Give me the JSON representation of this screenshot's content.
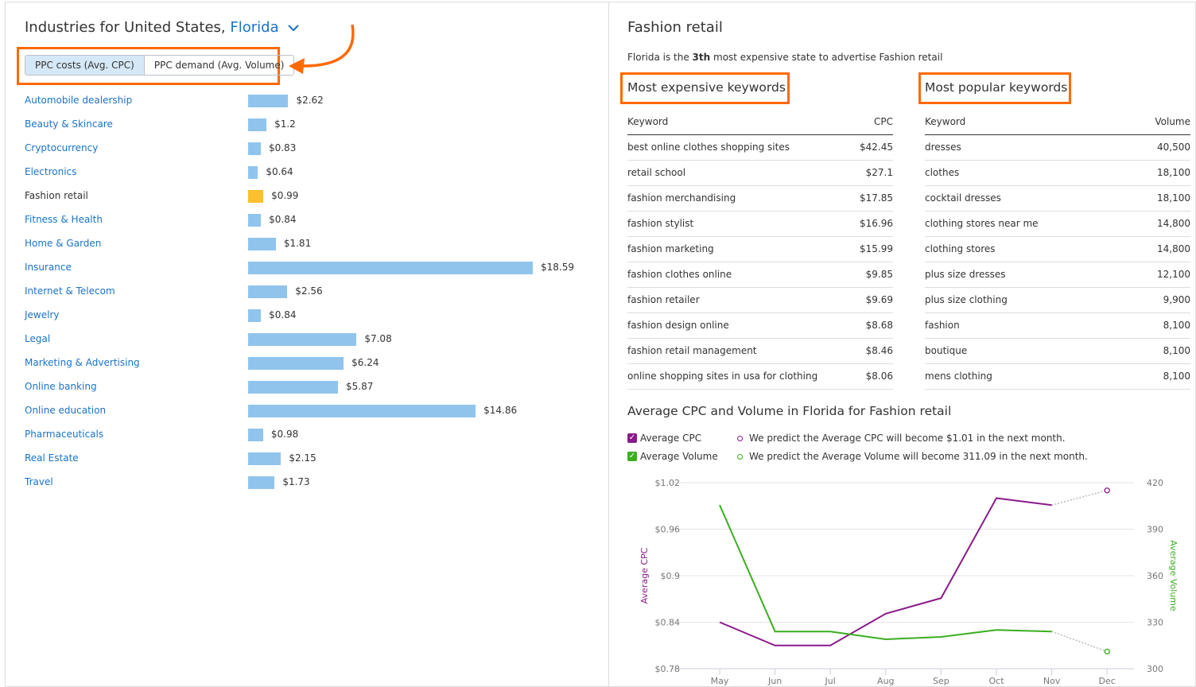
{
  "left": {
    "title_prefix": "Industries for United States,",
    "state": "Florida",
    "toggle": {
      "cpc": "PPC costs (Avg. CPC)",
      "volume": "PPC demand (Avg. Volume)",
      "active": "cpc"
    },
    "industries": [
      {
        "name": "Automobile dealership",
        "cpc": 2.62,
        "label": "$2.62"
      },
      {
        "name": "Beauty & Skincare",
        "cpc": 1.2,
        "label": "$1.2"
      },
      {
        "name": "Cryptocurrency",
        "cpc": 0.83,
        "label": "$0.83"
      },
      {
        "name": "Electronics",
        "cpc": 0.64,
        "label": "$0.64"
      },
      {
        "name": "Fashion retail",
        "cpc": 0.99,
        "label": "$0.99",
        "selected": true
      },
      {
        "name": "Fitness & Health",
        "cpc": 0.84,
        "label": "$0.84"
      },
      {
        "name": "Home & Garden",
        "cpc": 1.81,
        "label": "$1.81"
      },
      {
        "name": "Insurance",
        "cpc": 18.59,
        "label": "$18.59"
      },
      {
        "name": "Internet & Telecom",
        "cpc": 2.56,
        "label": "$2.56"
      },
      {
        "name": "Jewelry",
        "cpc": 0.84,
        "label": "$0.84"
      },
      {
        "name": "Legal",
        "cpc": 7.08,
        "label": "$7.08"
      },
      {
        "name": "Marketing & Advertising",
        "cpc": 6.24,
        "label": "$6.24"
      },
      {
        "name": "Online banking",
        "cpc": 5.87,
        "label": "$5.87"
      },
      {
        "name": "Online education",
        "cpc": 14.86,
        "label": "$14.86"
      },
      {
        "name": "Pharmaceuticals",
        "cpc": 0.98,
        "label": "$0.98"
      },
      {
        "name": "Real Estate",
        "cpc": 2.15,
        "label": "$2.15"
      },
      {
        "name": "Travel",
        "cpc": 1.73,
        "label": "$1.73"
      }
    ]
  },
  "right": {
    "title": "Fashion retail",
    "summary": {
      "prefix": "Florida is the ",
      "rank": "3th",
      "suffix": " most expensive state to advertise Fashion retail"
    },
    "expensive": {
      "title": "Most expensive keywords",
      "col1": "Keyword",
      "col2": "CPC",
      "rows": [
        [
          "best online clothes shopping sites",
          "$42.45"
        ],
        [
          "retail school",
          "$27.1"
        ],
        [
          "fashion merchandising",
          "$17.85"
        ],
        [
          "fashion stylist",
          "$16.96"
        ],
        [
          "fashion marketing",
          "$15.99"
        ],
        [
          "fashion clothes online",
          "$9.85"
        ],
        [
          "fashion retailer",
          "$9.69"
        ],
        [
          "fashion design online",
          "$8.68"
        ],
        [
          "fashion retail management",
          "$8.46"
        ],
        [
          "online shopping sites in usa for clothing",
          "$8.06"
        ]
      ]
    },
    "popular": {
      "title": "Most popular keywords",
      "col1": "Keyword",
      "col2": "Volume",
      "rows": [
        [
          "dresses",
          "40,500"
        ],
        [
          "clothes",
          "18,100"
        ],
        [
          "cocktail dresses",
          "18,100"
        ],
        [
          "clothing stores near me",
          "14,800"
        ],
        [
          "clothing stores",
          "14,800"
        ],
        [
          "plus size dresses",
          "12,100"
        ],
        [
          "plus size clothing",
          "9,900"
        ],
        [
          "fashion",
          "8,100"
        ],
        [
          "boutique",
          "8,100"
        ],
        [
          "mens clothing",
          "8,100"
        ]
      ]
    },
    "chart_title": "Average CPC and Volume in Florida for Fashion retail",
    "legend": {
      "cpc": "Average CPC",
      "volume": "Average Volume",
      "cpc_prediction": "We predict the Average CPC will become $1.01 in the next month.",
      "volume_prediction": "We predict the Average Volume will become 311.09 in the next month."
    }
  },
  "colors": {
    "accent": "#ff6a00",
    "bar": "#90c4ed",
    "bar_selected": "#fbc02d",
    "cpc": "#8a1a8a",
    "volume": "#3aae1f",
    "link": "#1a73c8"
  },
  "chart_data": {
    "type": "line",
    "title": "Average CPC and Volume in Florida for Fashion retail",
    "categories": [
      "May",
      "Jun",
      "Jul",
      "Aug",
      "Sep",
      "Oct",
      "Nov",
      "Dec"
    ],
    "y_left": {
      "label": "Average CPC",
      "ticks": [
        "$0.78",
        "$0.84",
        "$0.9",
        "$0.96",
        "$1.02"
      ],
      "range": [
        0.78,
        1.02
      ]
    },
    "y_right": {
      "label": "Average Volume",
      "ticks": [
        "300",
        "330",
        "360",
        "390",
        "420"
      ],
      "range": [
        300,
        420
      ]
    },
    "grid": true,
    "series": [
      {
        "name": "Average CPC",
        "axis": "left",
        "values": [
          0.84,
          0.81,
          0.81,
          0.851,
          0.871,
          1.0,
          0.991,
          null
        ],
        "predicted": {
          "category": "Dec",
          "value": 1.01
        }
      },
      {
        "name": "Average Volume",
        "axis": "right",
        "values": [
          405.6,
          324,
          324,
          319,
          320.5,
          325,
          324,
          null
        ],
        "predicted": {
          "category": "Dec",
          "value": 311.09
        }
      }
    ]
  }
}
